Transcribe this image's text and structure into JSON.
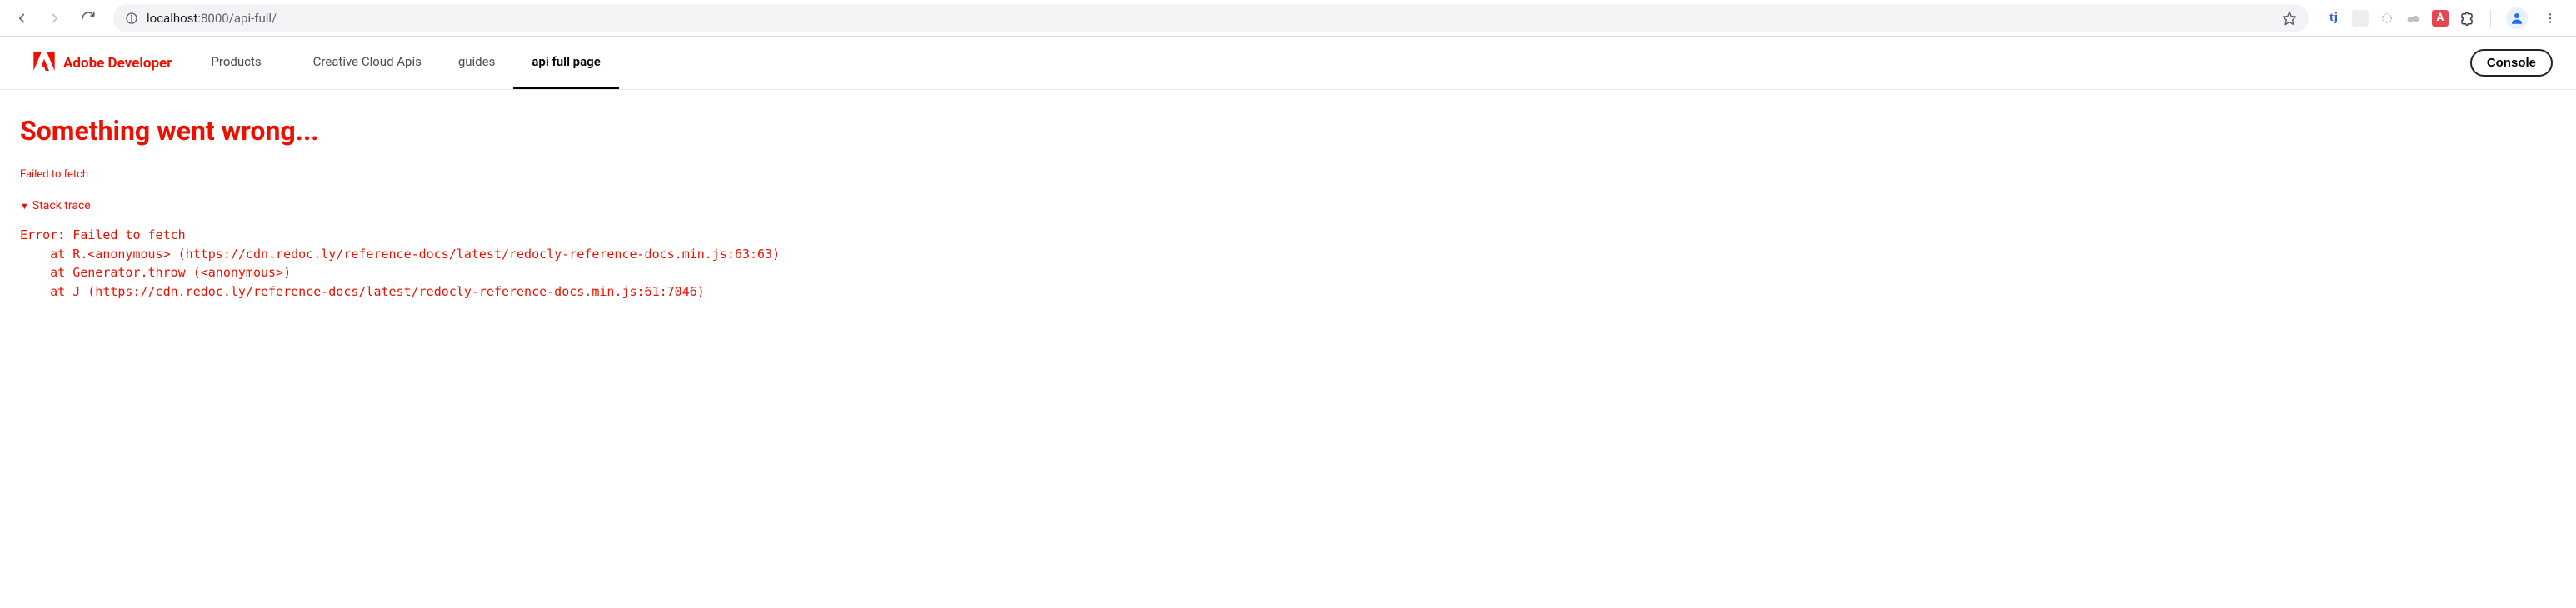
{
  "browser": {
    "url_host": "localhost",
    "url_port_path": ":8000/api-full/",
    "ext_tj": "tj",
    "ext_a": "A"
  },
  "header": {
    "brand": "Adobe Developer",
    "nav": {
      "products": "Products",
      "creative_cloud_apis": "Creative Cloud Apis",
      "guides": "guides",
      "api_full_page": "api full page"
    },
    "console_label": "Console"
  },
  "error": {
    "heading": "Something went wrong...",
    "message": "Failed to fetch",
    "stack_label": "Stack trace",
    "stack": "Error: Failed to fetch\n    at R.<anonymous> (https://cdn.redoc.ly/reference-docs/latest/redocly-reference-docs.min.js:63:63)\n    at Generator.throw (<anonymous>)\n    at J (https://cdn.redoc.ly/reference-docs/latest/redocly-reference-docs.min.js:61:7046)"
  }
}
